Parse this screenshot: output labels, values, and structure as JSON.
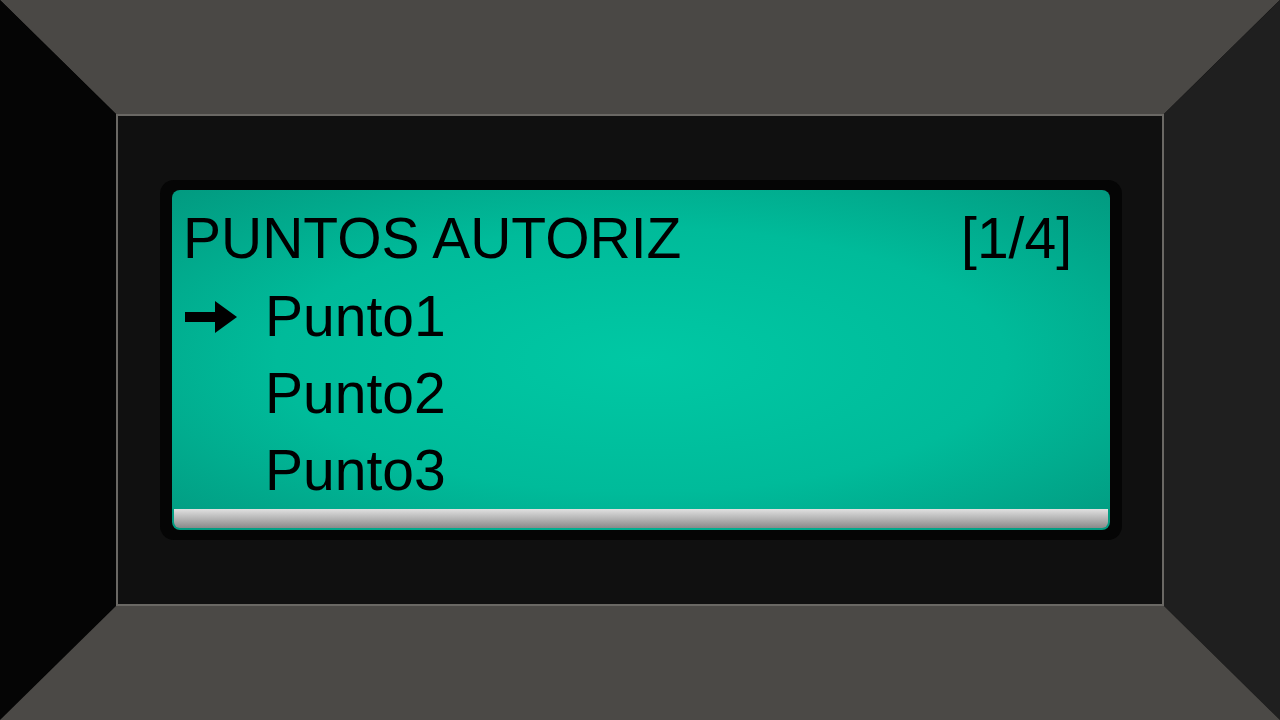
{
  "header": {
    "title": "PUNTOS AUTORIZ",
    "page": "[1/4]"
  },
  "items": [
    {
      "label": "Punto1",
      "selected": true
    },
    {
      "label": "Punto2",
      "selected": false
    },
    {
      "label": "Punto3",
      "selected": false
    }
  ]
}
